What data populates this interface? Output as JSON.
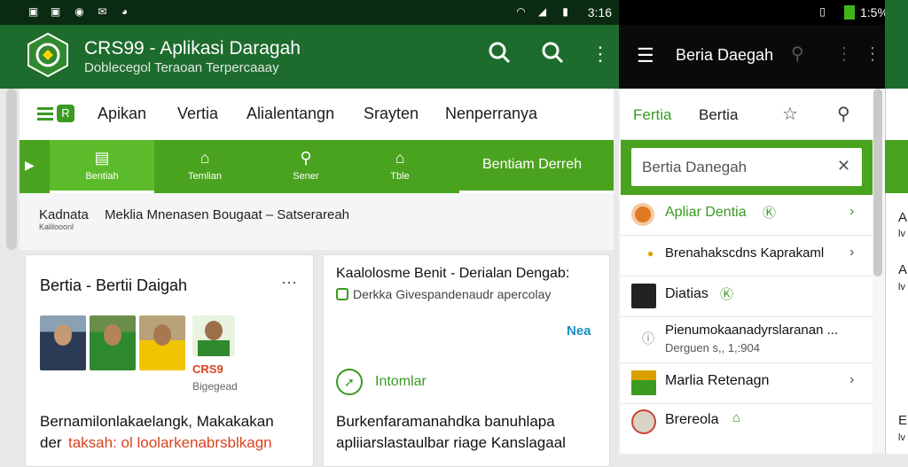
{
  "status_left": {
    "time": "3:16"
  },
  "header": {
    "title": "CRS99 - Aplikasi Daragah",
    "subtitle": "Doblecegol Teraoan Terpercaaay"
  },
  "nav": {
    "items": [
      "Apikan",
      "Vertia",
      "Alialentangn",
      "Srayten",
      "Nenperranya"
    ]
  },
  "tabs": {
    "items": [
      {
        "label": "Bentiah",
        "icon": "tablet-icon"
      },
      {
        "label": "Temlian",
        "icon": "home-icon"
      },
      {
        "label": "Sener",
        "icon": "search-icon"
      },
      {
        "label": "Tble",
        "icon": "house-icon"
      }
    ],
    "right_label": "Bentiam Derreh"
  },
  "breadcrumb": {
    "home": "Kadnata",
    "home_sub": "Kalilooonl",
    "path": "Meklia Mnenasen Bougaat – Satserareah"
  },
  "card1": {
    "title": "Bertia - Bertii Daigah",
    "more": "···",
    "logo_label": "CRS9",
    "logo_sub": "Bigegead",
    "body_line1": "Bernamilonlakaelangk, Makakakan",
    "body_line2_prefix": "der",
    "body_line2_red": "taksah: ol loolarkenabrsblkagn"
  },
  "card2": {
    "title": "Kaalolosme Benit - Derialan Dengab:",
    "subtitle": "Derkka Givespandenaudr apercolay",
    "badge": "Nea",
    "action": "Intomlar",
    "body_line1": "Burkenfaramanahdka banuhlapa",
    "body_line2": "apliiarslastaulbar riage Kanslagaal"
  },
  "status_right": {
    "time": "1:5%"
  },
  "right_panel": {
    "title": "Beria Daegah",
    "tabs": [
      "Fertia",
      "Bertia"
    ],
    "search_value": "Bertia Danegah",
    "rows": [
      {
        "label": "Apliar Dentia",
        "badge": "Ⓚ"
      },
      {
        "label": "Brenahakscdns Kaprakaml"
      },
      {
        "label": "Diatias",
        "badge": "Ⓚ"
      },
      {
        "label": "Pienumokaanadyrslaranan ...",
        "sub": "Derguen s,, 1,:904"
      },
      {
        "label": "Marlia Retenagn"
      },
      {
        "label": "Brereola",
        "badge": "⌂"
      }
    ]
  },
  "edge": {
    "letters": [
      "A",
      "lv",
      "A",
      "lv",
      "E",
      "lv"
    ]
  },
  "colors": {
    "primary": "#1e6b2e",
    "accent": "#4aa31e",
    "active_tab": "#5cbb2a",
    "red": "#d9421f"
  }
}
